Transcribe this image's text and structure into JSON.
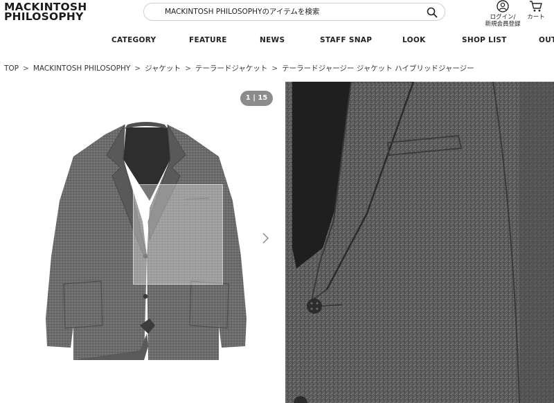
{
  "brand": {
    "line1": "MACKINTOSH",
    "line2": "PHILOSOPHY"
  },
  "search": {
    "placeholder": "MACKINTOSH PHILOSOPHYのアイテムを検索",
    "icon": "search-icon"
  },
  "header": {
    "login_line1": "ログイン/",
    "login_line2": "新規会員登録",
    "cart_label": "カート",
    "login_icon": "user-icon",
    "cart_icon": "cart-icon"
  },
  "nav": [
    "CATEGORY",
    "FEATURE",
    "NEWS",
    "STAFF SNAP",
    "LOOK",
    "SHOP LIST",
    "OUT"
  ],
  "breadcrumb": [
    "TOP",
    "MACKINTOSH PHILOSOPHY",
    "ジャケット",
    "テーラードジャケット",
    "テーラードジャージー ジャケット ハイブリッドジャージー"
  ],
  "gallery": {
    "counter": "1 | 15",
    "next_icon": "chevron-right-icon"
  },
  "colors": {
    "jacket": "#6e6e6e",
    "jacket_dark": "#4a4a4a",
    "counter_bg": "#8c8c8c"
  }
}
